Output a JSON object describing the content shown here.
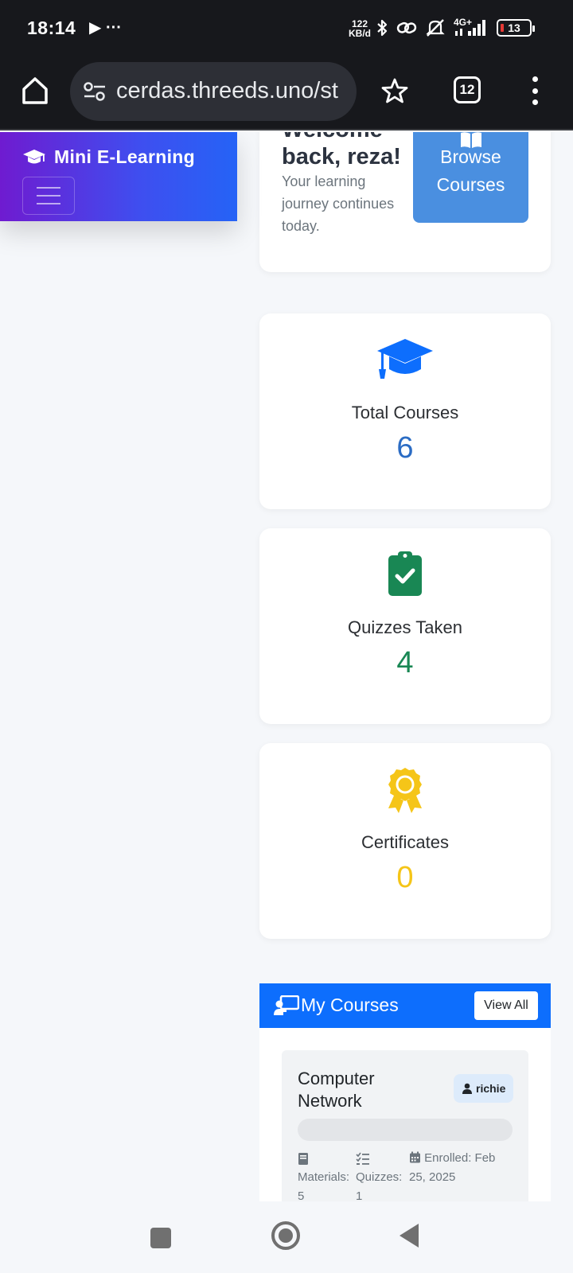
{
  "status_bar": {
    "time": "18:14",
    "left_icons": "▶ ···",
    "net_speed_value": "122",
    "net_speed_unit": "KB/d",
    "network": "4G+",
    "battery": "13"
  },
  "browser": {
    "url": "cerdas.threeds.uno/st",
    "tab_count": "12"
  },
  "nav": {
    "brand": "Mini E-Learning"
  },
  "welcome": {
    "title_line1": "Welcome",
    "title_line2": "back, reza!",
    "subtitle": "Your learning journey continues today.",
    "browse_line1": "Browse",
    "browse_line2": "Courses"
  },
  "stats": [
    {
      "label": "Total Courses",
      "value": "6",
      "color": "#2b6cc4",
      "icon": "graduation-cap-icon"
    },
    {
      "label": "Quizzes Taken",
      "value": "4",
      "color": "#198754",
      "icon": "clipboard-check-icon"
    },
    {
      "label": "Certificates",
      "value": "0",
      "color": "#f5c518",
      "icon": "award-icon"
    }
  ],
  "my_courses": {
    "title": "My Courses",
    "view_all": "View All",
    "courses": [
      {
        "name": "Computer Network",
        "instructor": "richie",
        "progress": 0,
        "materials_label": "Materials:",
        "materials_value": "5",
        "quizzes_label": "Quizzes:",
        "quizzes_value": "1",
        "enrolled_line1": "Enrolled: Feb",
        "enrolled_line2": "25, 2025"
      }
    ]
  },
  "colors": {
    "primary": "#0d6efd",
    "gradient_start": "#6f1bd0",
    "gradient_end": "#2563f6",
    "browse_button": "#4a8fe0"
  }
}
